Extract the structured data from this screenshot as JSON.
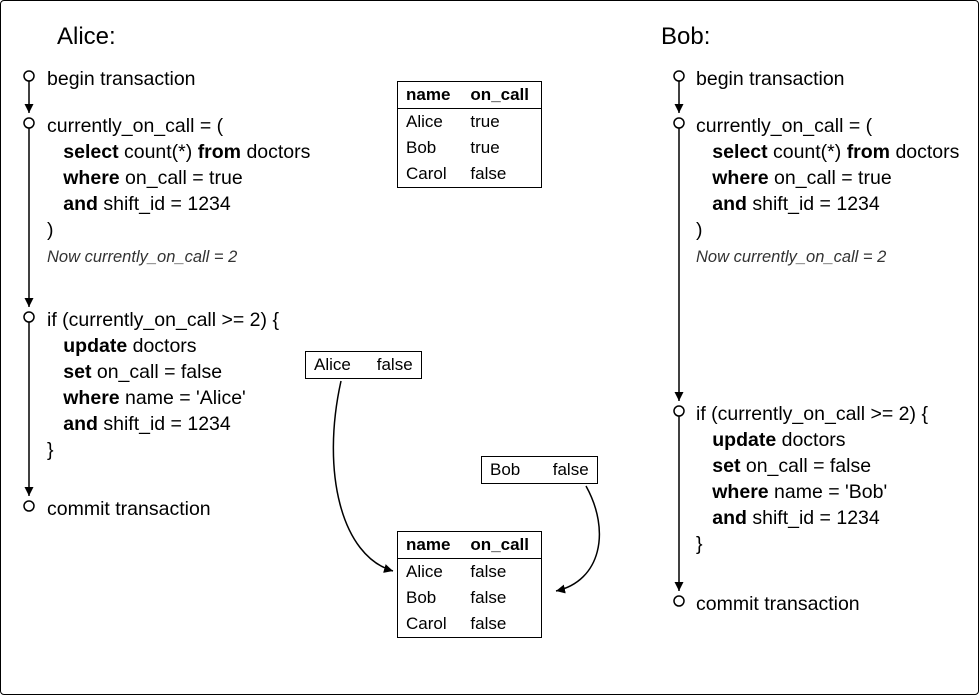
{
  "actors": {
    "alice": {
      "title": "Alice:"
    },
    "bob": {
      "title": "Bob:"
    }
  },
  "steps": {
    "begin": "begin transaction",
    "query_open": "currently_on_call = (",
    "query_select_kw": "select",
    "query_count": " count(*) ",
    "query_from_kw": "from",
    "query_from_tbl": " doctors",
    "query_where_kw": "where",
    "query_where_cond": " on_call = true",
    "query_and_kw": "and",
    "query_and_cond": " shift_id = 1234",
    "query_close": ")",
    "comment": "Now currently_on_call = 2",
    "if_open": "if (currently_on_call >= 2) {",
    "update_kw": "update",
    "update_tbl": " doctors",
    "set_kw": "set",
    "set_cond": " on_call = false",
    "where_kw": "where",
    "where_alice": " name = 'Alice'",
    "where_bob": " name = 'Bob'",
    "and_kw": "and",
    "and_cond": " shift_id = 1234",
    "if_close": "}",
    "commit": "commit transaction"
  },
  "table_initial": {
    "headers": {
      "name": "name",
      "on_call": "on_call"
    },
    "rows": [
      {
        "name": "Alice",
        "on_call": "true"
      },
      {
        "name": "Bob",
        "on_call": "true"
      },
      {
        "name": "Carol",
        "on_call": "false"
      }
    ]
  },
  "update_alice": {
    "name": "Alice",
    "on_call": "false"
  },
  "update_bob": {
    "name": "Bob",
    "on_call": "false"
  },
  "table_final": {
    "headers": {
      "name": "name",
      "on_call": "on_call"
    },
    "rows": [
      {
        "name": "Alice",
        "on_call": "false"
      },
      {
        "name": "Bob",
        "on_call": "false"
      },
      {
        "name": "Carol",
        "on_call": "false"
      }
    ]
  }
}
